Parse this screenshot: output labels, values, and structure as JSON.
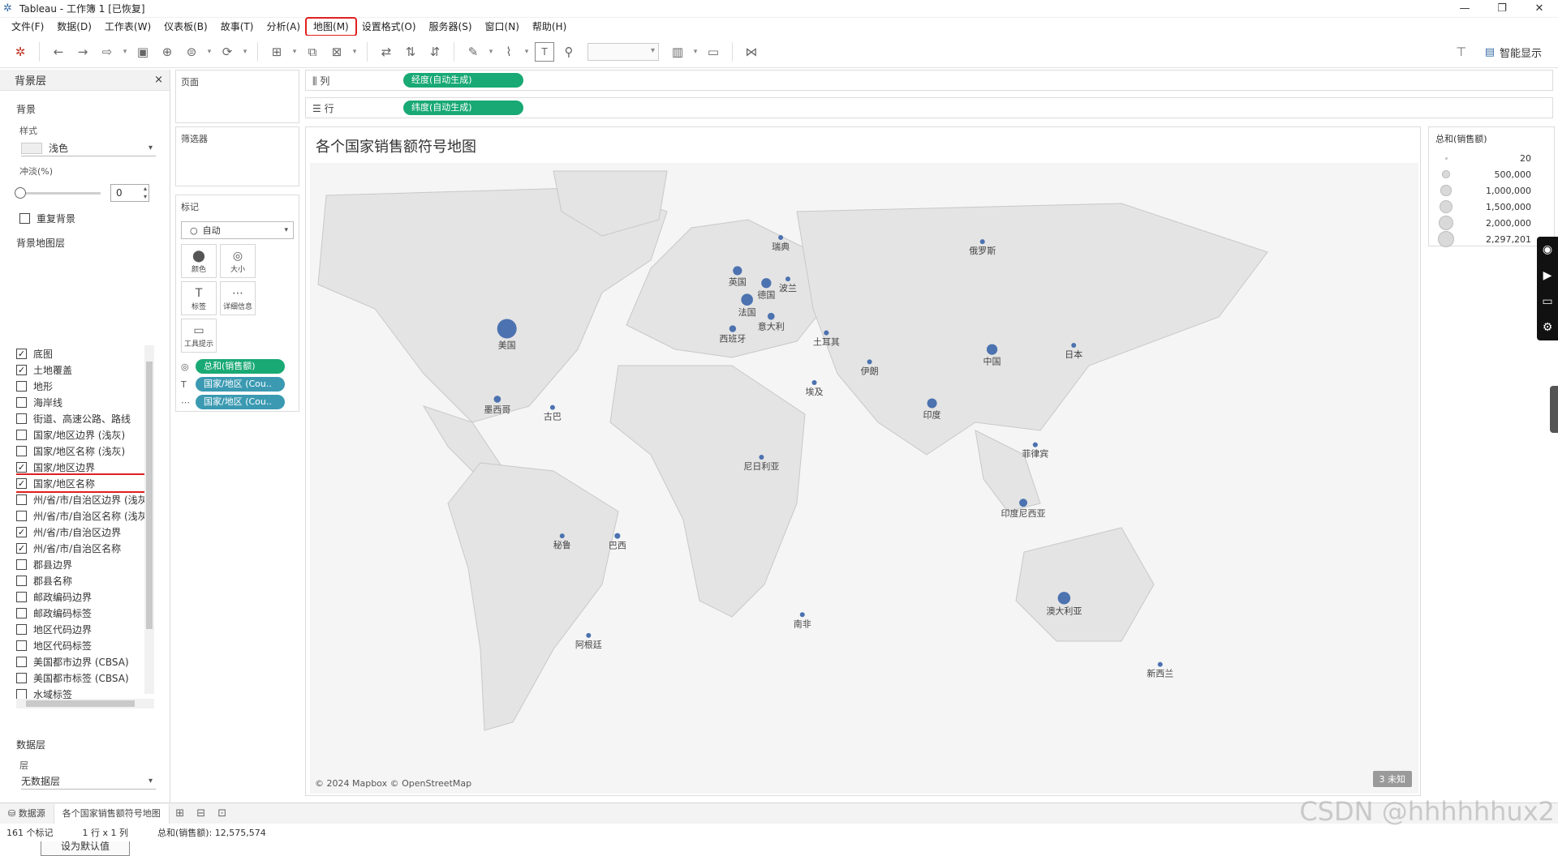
{
  "window": {
    "title": "Tableau - 工作簿 1 [已恢复]",
    "controls": [
      "—",
      "❐",
      "✕"
    ]
  },
  "menu": [
    "文件(F)",
    "数据(D)",
    "工作表(W)",
    "仪表板(B)",
    "故事(T)",
    "分析(A)",
    "地图(M)",
    "设置格式(O)",
    "服务器(S)",
    "窗口(N)",
    "帮助(H)"
  ],
  "menu_active_index": 6,
  "toolbar": {
    "smart_show": "智能显示"
  },
  "background_pane": {
    "title": "背景层",
    "close": "×",
    "section_background": "背景",
    "style_label": "样式",
    "style_value": "浅色",
    "washout_label": "冲淡(%)",
    "washout_value": "0",
    "washout_percent": 0,
    "repeat_background": "重复背景",
    "map_layers_title": "背景地图层",
    "layers": [
      {
        "label": "底图",
        "checked": true
      },
      {
        "label": "土地覆盖",
        "checked": true
      },
      {
        "label": "地形",
        "checked": false
      },
      {
        "label": "海岸线",
        "checked": false
      },
      {
        "label": "街道、高速公路、路线",
        "checked": false
      },
      {
        "label": "国家/地区边界 (浅灰)",
        "checked": false
      },
      {
        "label": "国家/地区名称 (浅灰)",
        "checked": false
      },
      {
        "label": "国家/地区边界",
        "checked": true
      },
      {
        "label": "国家/地区名称",
        "checked": true,
        "highlight": true
      },
      {
        "label": "州/省/市/自治区边界 (浅灰)",
        "checked": false
      },
      {
        "label": "州/省/市/自治区名称 (浅灰)",
        "checked": false
      },
      {
        "label": "州/省/市/自治区边界",
        "checked": true
      },
      {
        "label": "州/省/市/自治区名称",
        "checked": true
      },
      {
        "label": "郡县边界",
        "checked": false
      },
      {
        "label": "郡县名称",
        "checked": false
      },
      {
        "label": "邮政编码边界",
        "checked": false
      },
      {
        "label": "邮政编码标签",
        "checked": false
      },
      {
        "label": "地区代码边界",
        "checked": false
      },
      {
        "label": "地区代码标签",
        "checked": false
      },
      {
        "label": "美国都市边界 (CBSA)",
        "checked": false
      },
      {
        "label": "美国都市标签 (CBSA)",
        "checked": false
      },
      {
        "label": "水域标签",
        "checked": false
      }
    ],
    "data_layer_title": "数据层",
    "layer_label": "层",
    "layer_value": "无数据层",
    "set_default": "设为默认值"
  },
  "cards": {
    "pages": "页面",
    "filters": "筛选器",
    "marks": "标记",
    "mark_type": "自动",
    "mark_buttons": [
      {
        "label": "颜色",
        "icon": "⬤"
      },
      {
        "label": "大小",
        "icon": "◎"
      },
      {
        "label": "标签",
        "icon": "T"
      },
      {
        "label": "详细信息",
        "icon": "⋯"
      },
      {
        "label": "工具提示",
        "icon": "▭"
      }
    ],
    "mark_pills": [
      {
        "icon": "◎",
        "label": "总和(销售额)",
        "color": "#19a974"
      },
      {
        "icon": "T",
        "label": "国家/地区 (Cou..",
        "color": "#3b9ab2"
      },
      {
        "icon": "⋯",
        "label": "国家/地区 (Cou..",
        "color": "#3b9ab2"
      }
    ]
  },
  "shelves": {
    "columns_label": "列",
    "columns_pill": "经度(自动生成)",
    "rows_label": "行",
    "rows_pill": "纬度(自动生成)"
  },
  "view": {
    "title": "各个国家销售额符号地图",
    "attribution": "© 2024 Mapbox © OpenStreetMap",
    "unknown_badge": "3 未知",
    "countries": [
      {
        "name": "美国",
        "lon": -98,
        "lat": 40,
        "sales": 2297201
      },
      {
        "name": "墨西哥",
        "lon": -102,
        "lat": 23,
        "sales": 300000
      },
      {
        "name": "巴西",
        "lon": -52,
        "lat": -10,
        "sales": 200000
      },
      {
        "name": "法国",
        "lon": 2,
        "lat": 47,
        "sales": 850000
      },
      {
        "name": "德国",
        "lon": 10,
        "lat": 51,
        "sales": 600000
      },
      {
        "name": "英国",
        "lon": -2,
        "lat": 54,
        "sales": 500000
      },
      {
        "name": "意大利",
        "lon": 12,
        "lat": 43,
        "sales": 300000
      },
      {
        "name": "西班牙",
        "lon": -4,
        "lat": 40,
        "sales": 280000
      },
      {
        "name": "中国",
        "lon": 104,
        "lat": 35,
        "sales": 700000
      },
      {
        "name": "印度",
        "lon": 79,
        "lat": 22,
        "sales": 580000
      },
      {
        "name": "印度尼西亚",
        "lon": 117,
        "lat": -2,
        "sales": 400000
      },
      {
        "name": "澳大利亚",
        "lon": 134,
        "lat": -25,
        "sales": 950000
      },
      {
        "name": "日本",
        "lon": 138,
        "lat": 36,
        "sales": 100000
      },
      {
        "name": "菲律宾",
        "lon": 122,
        "lat": 12,
        "sales": 150000
      },
      {
        "name": "俄罗斯",
        "lon": 100,
        "lat": 61,
        "sales": 100000
      },
      {
        "name": "新西兰",
        "lon": 174,
        "lat": -41,
        "sales": 100000
      },
      {
        "name": "尼日利亚",
        "lon": 8,
        "lat": 9,
        "sales": 120000
      },
      {
        "name": "埃及",
        "lon": 30,
        "lat": 27,
        "sales": 90000
      },
      {
        "name": "土耳其",
        "lon": 35,
        "lat": 39,
        "sales": 150000
      },
      {
        "name": "伊朗",
        "lon": 53,
        "lat": 32,
        "sales": 80000
      },
      {
        "name": "南非",
        "lon": 25,
        "lat": -29,
        "sales": 80000
      },
      {
        "name": "古巴",
        "lon": -79,
        "lat": 21,
        "sales": 80000
      },
      {
        "name": "秘鲁",
        "lon": -75,
        "lat": -10,
        "sales": 60000
      },
      {
        "name": "阿根廷",
        "lon": -64,
        "lat": -34,
        "sales": 60000
      },
      {
        "name": "波兰",
        "lon": 19,
        "lat": 52,
        "sales": 100000
      },
      {
        "name": "瑞典",
        "lon": 16,
        "lat": 62,
        "sales": 80000
      }
    ]
  },
  "legend": {
    "title": "总和(销售额)",
    "items": [
      {
        "value": "20",
        "amount": 20
      },
      {
        "value": "500,000",
        "amount": 500000
      },
      {
        "value": "1,000,000",
        "amount": 1000000
      },
      {
        "value": "1,500,000",
        "amount": 1500000
      },
      {
        "value": "2,000,000",
        "amount": 2000000
      },
      {
        "value": "2,297,201",
        "amount": 2297201
      }
    ]
  },
  "tabs": {
    "datasource": "数据源",
    "sheet": "各个国家销售额符号地图"
  },
  "status": {
    "marks": "161 个标记",
    "rows_cols": "1 行 x 1 列",
    "sum": "总和(销售额): 12,575,574"
  },
  "watermark": "CSDN @hhhhhhux2",
  "colors": {
    "mark": "#4c72b0",
    "accent_green": "#19a974",
    "accent_blue": "#3b9ab2",
    "highlight": "#e02020"
  }
}
